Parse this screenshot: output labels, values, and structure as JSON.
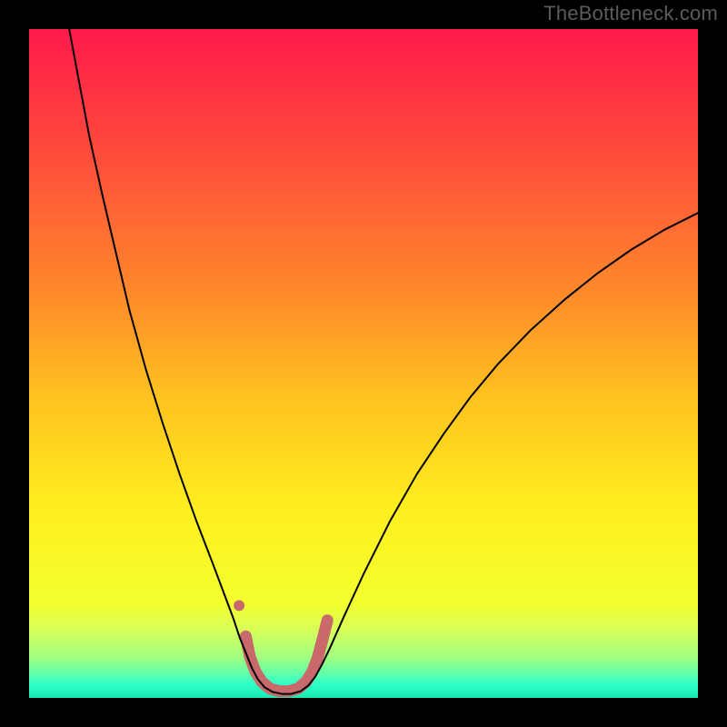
{
  "watermark": "TheBottleneck.com",
  "chart_data": {
    "type": "line",
    "title": "",
    "xlabel": "",
    "ylabel": "",
    "xlim": [
      0,
      100
    ],
    "ylim": [
      0,
      100
    ],
    "gradient_stops": [
      {
        "offset": 0.0,
        "color": "#ff1a4b"
      },
      {
        "offset": 0.2,
        "color": "#ff4f3a"
      },
      {
        "offset": 0.4,
        "color": "#ff8b2a"
      },
      {
        "offset": 0.55,
        "color": "#ffc21f"
      },
      {
        "offset": 0.72,
        "color": "#ffef1f"
      },
      {
        "offset": 0.86,
        "color": "#f3ff2f"
      },
      {
        "offset": 0.9,
        "color": "#d6ff5a"
      },
      {
        "offset": 0.94,
        "color": "#9fff81"
      },
      {
        "offset": 0.965,
        "color": "#5cffad"
      },
      {
        "offset": 0.98,
        "color": "#2fffc9"
      },
      {
        "offset": 1.0,
        "color": "#18e8b2"
      }
    ],
    "series": [
      {
        "name": "bottleneck-curve",
        "stroke": "#000000",
        "stroke_width": 2,
        "points": [
          {
            "x": 6.0,
            "y": 100.0
          },
          {
            "x": 7.5,
            "y": 92.0
          },
          {
            "x": 9.0,
            "y": 84.0
          },
          {
            "x": 11.0,
            "y": 75.0
          },
          {
            "x": 13.0,
            "y": 66.5
          },
          {
            "x": 15.0,
            "y": 58.0
          },
          {
            "x": 17.5,
            "y": 49.0
          },
          {
            "x": 20.0,
            "y": 41.0
          },
          {
            "x": 22.5,
            "y": 33.5
          },
          {
            "x": 25.0,
            "y": 26.5
          },
          {
            "x": 27.5,
            "y": 20.0
          },
          {
            "x": 29.0,
            "y": 16.0
          },
          {
            "x": 30.5,
            "y": 12.0
          },
          {
            "x": 31.5,
            "y": 9.0
          },
          {
            "x": 32.5,
            "y": 6.5
          },
          {
            "x": 33.3,
            "y": 4.5
          },
          {
            "x": 34.2,
            "y": 2.8
          },
          {
            "x": 35.2,
            "y": 1.6
          },
          {
            "x": 36.4,
            "y": 0.9
          },
          {
            "x": 37.8,
            "y": 0.6
          },
          {
            "x": 39.2,
            "y": 0.6
          },
          {
            "x": 40.6,
            "y": 1.0
          },
          {
            "x": 41.8,
            "y": 1.9
          },
          {
            "x": 42.8,
            "y": 3.2
          },
          {
            "x": 43.8,
            "y": 5.0
          },
          {
            "x": 45.0,
            "y": 7.5
          },
          {
            "x": 47.0,
            "y": 12.0
          },
          {
            "x": 50.0,
            "y": 18.5
          },
          {
            "x": 54.0,
            "y": 26.5
          },
          {
            "x": 58.0,
            "y": 33.5
          },
          {
            "x": 62.0,
            "y": 39.5
          },
          {
            "x": 66.0,
            "y": 45.0
          },
          {
            "x": 70.0,
            "y": 49.8
          },
          {
            "x": 75.0,
            "y": 55.0
          },
          {
            "x": 80.0,
            "y": 59.5
          },
          {
            "x": 85.0,
            "y": 63.5
          },
          {
            "x": 90.0,
            "y": 67.0
          },
          {
            "x": 95.0,
            "y": 70.0
          },
          {
            "x": 100.0,
            "y": 72.5
          }
        ]
      },
      {
        "name": "highlight-band",
        "stroke": "#c9696c",
        "stroke_width": 13,
        "points": [
          {
            "x": 32.4,
            "y": 9.2
          },
          {
            "x": 33.0,
            "y": 6.2
          },
          {
            "x": 33.8,
            "y": 4.0
          },
          {
            "x": 34.8,
            "y": 2.4
          },
          {
            "x": 36.0,
            "y": 1.4
          },
          {
            "x": 37.4,
            "y": 1.0
          },
          {
            "x": 38.8,
            "y": 1.0
          },
          {
            "x": 40.2,
            "y": 1.4
          },
          {
            "x": 41.4,
            "y": 2.4
          },
          {
            "x": 42.4,
            "y": 4.0
          },
          {
            "x": 43.2,
            "y": 6.2
          },
          {
            "x": 43.9,
            "y": 8.8
          },
          {
            "x": 44.6,
            "y": 11.6
          }
        ]
      },
      {
        "name": "highlight-dot",
        "stroke": "#c9696c",
        "marker_radius": 6,
        "points": [
          {
            "x": 31.4,
            "y": 13.8
          }
        ]
      }
    ]
  }
}
